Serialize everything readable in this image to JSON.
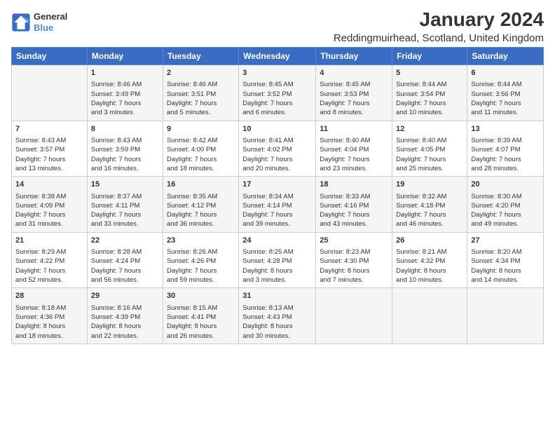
{
  "header": {
    "title": "January 2024",
    "subtitle": "Reddingmuirhead, Scotland, United Kingdom",
    "logo_line1": "General",
    "logo_line2": "Blue"
  },
  "days_of_week": [
    "Sunday",
    "Monday",
    "Tuesday",
    "Wednesday",
    "Thursday",
    "Friday",
    "Saturday"
  ],
  "weeks": [
    [
      {
        "day": "",
        "content": ""
      },
      {
        "day": "1",
        "content": "Sunrise: 8:46 AM\nSunset: 3:49 PM\nDaylight: 7 hours\nand 3 minutes."
      },
      {
        "day": "2",
        "content": "Sunrise: 8:46 AM\nSunset: 3:51 PM\nDaylight: 7 hours\nand 5 minutes."
      },
      {
        "day": "3",
        "content": "Sunrise: 8:45 AM\nSunset: 3:52 PM\nDaylight: 7 hours\nand 6 minutes."
      },
      {
        "day": "4",
        "content": "Sunrise: 8:45 AM\nSunset: 3:53 PM\nDaylight: 7 hours\nand 8 minutes."
      },
      {
        "day": "5",
        "content": "Sunrise: 8:44 AM\nSunset: 3:54 PM\nDaylight: 7 hours\nand 10 minutes."
      },
      {
        "day": "6",
        "content": "Sunrise: 8:44 AM\nSunset: 3:56 PM\nDaylight: 7 hours\nand 11 minutes."
      }
    ],
    [
      {
        "day": "7",
        "content": "Sunrise: 8:43 AM\nSunset: 3:57 PM\nDaylight: 7 hours\nand 13 minutes."
      },
      {
        "day": "8",
        "content": "Sunrise: 8:43 AM\nSunset: 3:59 PM\nDaylight: 7 hours\nand 16 minutes."
      },
      {
        "day": "9",
        "content": "Sunrise: 8:42 AM\nSunset: 4:00 PM\nDaylight: 7 hours\nand 18 minutes."
      },
      {
        "day": "10",
        "content": "Sunrise: 8:41 AM\nSunset: 4:02 PM\nDaylight: 7 hours\nand 20 minutes."
      },
      {
        "day": "11",
        "content": "Sunrise: 8:40 AM\nSunset: 4:04 PM\nDaylight: 7 hours\nand 23 minutes."
      },
      {
        "day": "12",
        "content": "Sunrise: 8:40 AM\nSunset: 4:05 PM\nDaylight: 7 hours\nand 25 minutes."
      },
      {
        "day": "13",
        "content": "Sunrise: 8:39 AM\nSunset: 4:07 PM\nDaylight: 7 hours\nand 28 minutes."
      }
    ],
    [
      {
        "day": "14",
        "content": "Sunrise: 8:38 AM\nSunset: 4:09 PM\nDaylight: 7 hours\nand 31 minutes."
      },
      {
        "day": "15",
        "content": "Sunrise: 8:37 AM\nSunset: 4:11 PM\nDaylight: 7 hours\nand 33 minutes."
      },
      {
        "day": "16",
        "content": "Sunrise: 8:35 AM\nSunset: 4:12 PM\nDaylight: 7 hours\nand 36 minutes."
      },
      {
        "day": "17",
        "content": "Sunrise: 8:34 AM\nSunset: 4:14 PM\nDaylight: 7 hours\nand 39 minutes."
      },
      {
        "day": "18",
        "content": "Sunrise: 8:33 AM\nSunset: 4:16 PM\nDaylight: 7 hours\nand 43 minutes."
      },
      {
        "day": "19",
        "content": "Sunrise: 8:32 AM\nSunset: 4:18 PM\nDaylight: 7 hours\nand 46 minutes."
      },
      {
        "day": "20",
        "content": "Sunrise: 8:30 AM\nSunset: 4:20 PM\nDaylight: 7 hours\nand 49 minutes."
      }
    ],
    [
      {
        "day": "21",
        "content": "Sunrise: 8:29 AM\nSunset: 4:22 PM\nDaylight: 7 hours\nand 52 minutes."
      },
      {
        "day": "22",
        "content": "Sunrise: 8:28 AM\nSunset: 4:24 PM\nDaylight: 7 hours\nand 56 minutes."
      },
      {
        "day": "23",
        "content": "Sunrise: 8:26 AM\nSunset: 4:26 PM\nDaylight: 7 hours\nand 59 minutes."
      },
      {
        "day": "24",
        "content": "Sunrise: 8:25 AM\nSunset: 4:28 PM\nDaylight: 8 hours\nand 3 minutes."
      },
      {
        "day": "25",
        "content": "Sunrise: 8:23 AM\nSunset: 4:30 PM\nDaylight: 8 hours\nand 7 minutes."
      },
      {
        "day": "26",
        "content": "Sunrise: 8:21 AM\nSunset: 4:32 PM\nDaylight: 8 hours\nand 10 minutes."
      },
      {
        "day": "27",
        "content": "Sunrise: 8:20 AM\nSunset: 4:34 PM\nDaylight: 8 hours\nand 14 minutes."
      }
    ],
    [
      {
        "day": "28",
        "content": "Sunrise: 8:18 AM\nSunset: 4:36 PM\nDaylight: 8 hours\nand 18 minutes."
      },
      {
        "day": "29",
        "content": "Sunrise: 8:16 AM\nSunset: 4:39 PM\nDaylight: 8 hours\nand 22 minutes."
      },
      {
        "day": "30",
        "content": "Sunrise: 8:15 AM\nSunset: 4:41 PM\nDaylight: 8 hours\nand 26 minutes."
      },
      {
        "day": "31",
        "content": "Sunrise: 8:13 AM\nSunset: 4:43 PM\nDaylight: 8 hours\nand 30 minutes."
      },
      {
        "day": "",
        "content": ""
      },
      {
        "day": "",
        "content": ""
      },
      {
        "day": "",
        "content": ""
      }
    ]
  ]
}
